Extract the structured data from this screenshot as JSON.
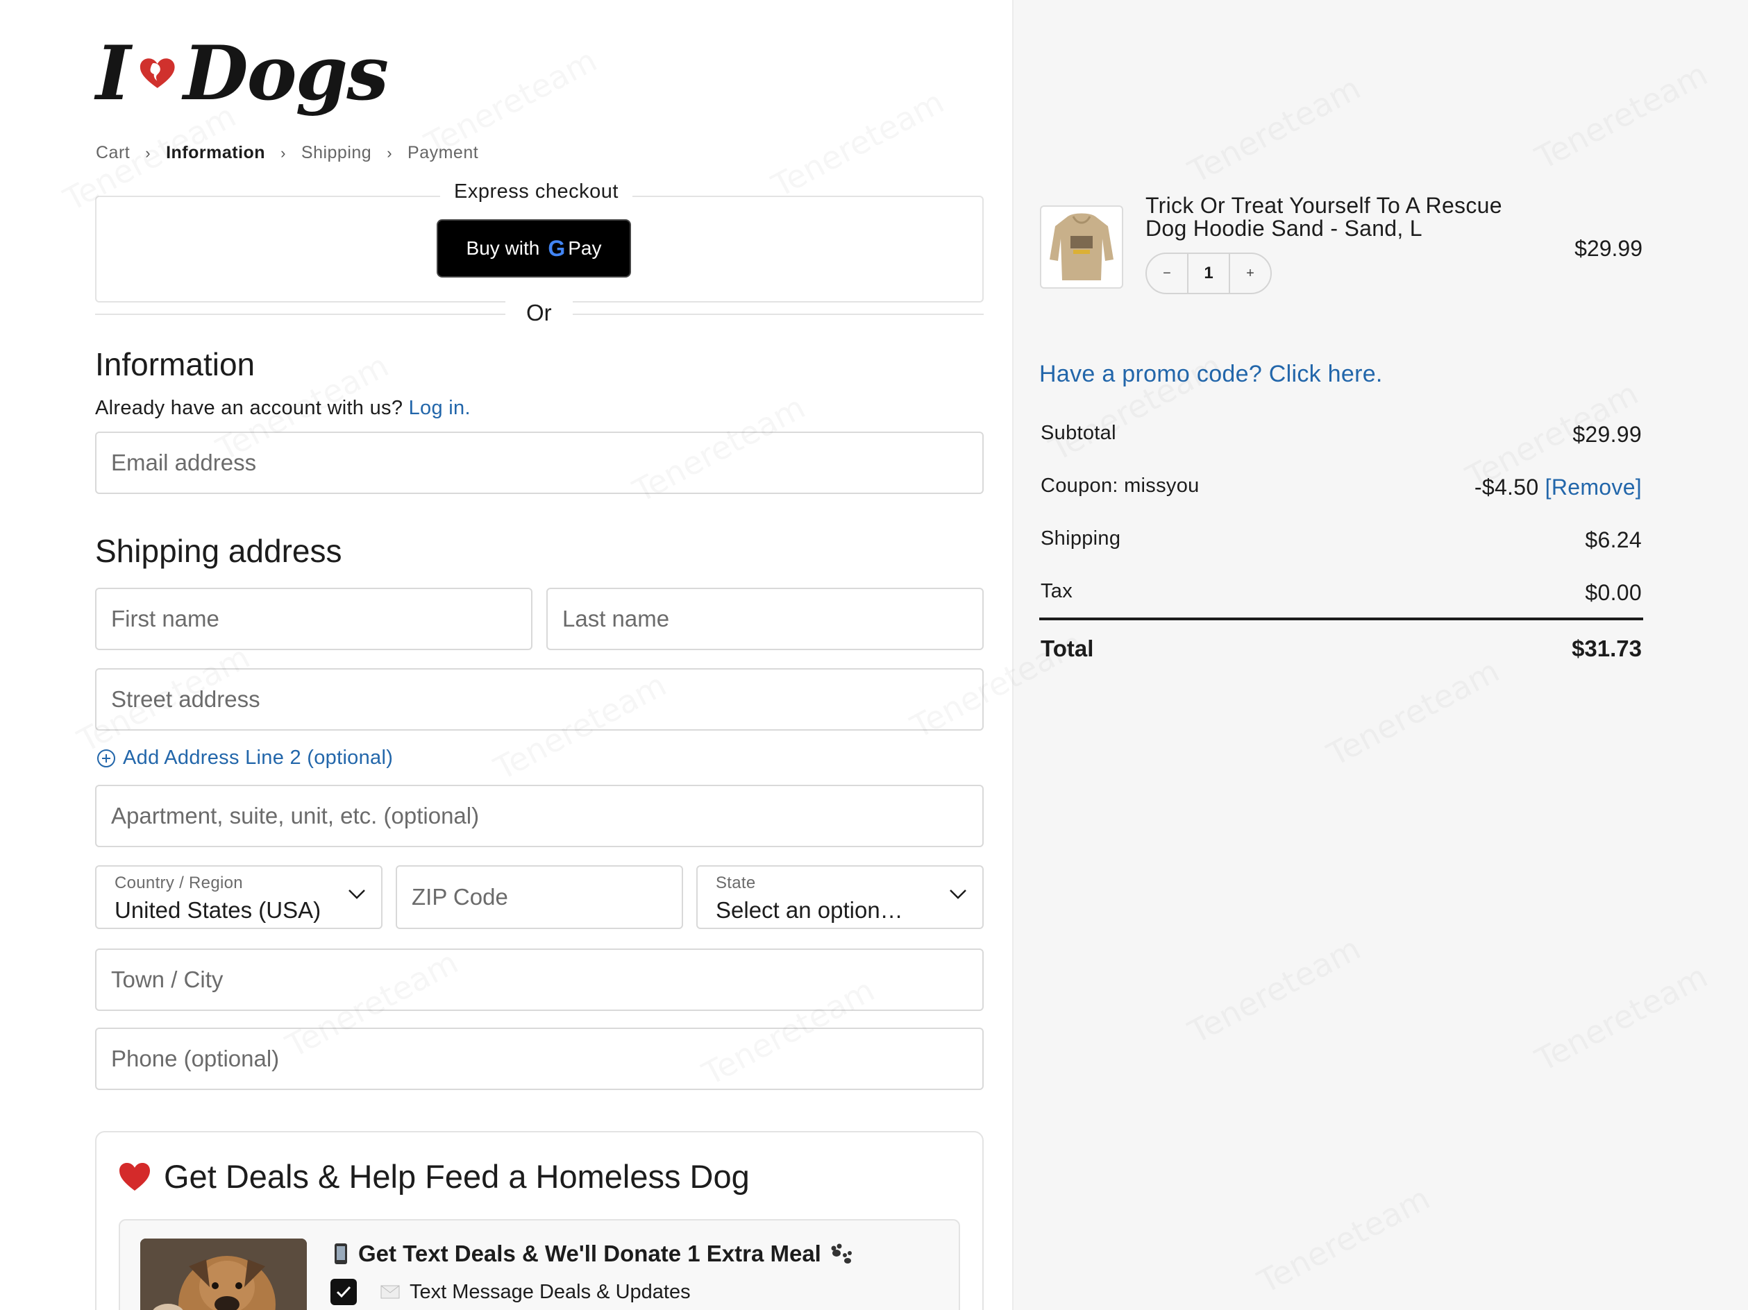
{
  "brand": {
    "logo_left": "I",
    "logo_right": "Dogs",
    "heart_color": "#d0312d"
  },
  "breadcrumb": [
    {
      "label": "Cart",
      "active": false
    },
    {
      "label": "Information",
      "active": true
    },
    {
      "label": "Shipping",
      "active": false
    },
    {
      "label": "Payment",
      "active": false
    }
  ],
  "express": {
    "label": "Express checkout",
    "button_prefix": "Buy with",
    "button_g": "G",
    "button_suffix": "Pay",
    "or_label": "Or"
  },
  "information": {
    "heading": "Information",
    "account_text": "Already have an account with us?",
    "login_link": "Log in.",
    "email_placeholder": "Email address"
  },
  "shipping": {
    "heading": "Shipping address",
    "first_name_placeholder": "First name",
    "last_name_placeholder": "Last name",
    "street_placeholder": "Street address",
    "add_line2_label": "Add Address Line 2 (optional)",
    "apartment_placeholder": "Apartment, suite, unit, etc. (optional)",
    "country_label": "Country / Region",
    "country_value": "United States (USA)",
    "zip_placeholder": "ZIP Code",
    "state_label": "State",
    "state_value": "Select an option…",
    "city_placeholder": "Town / City",
    "phone_placeholder": "Phone (optional)"
  },
  "deals": {
    "title": "Get Deals & Help Feed a Homeless Dog",
    "headline": "Get Text Deals & We'll Donate 1 Extra Meal",
    "checkbox_label": "Text Message Deals & Updates",
    "checkbox_checked": true
  },
  "cart": {
    "product_name": "Trick Or Treat Yourself To A Rescue Dog Hoodie Sand - Sand, L",
    "product_price": "$29.99",
    "quantity": "1",
    "qty_minus": "−",
    "qty_plus": "+",
    "promo_link": "Have a promo code? Click here.",
    "subtotal_label": "Subtotal",
    "subtotal_value": "$29.99",
    "coupon_label": "Coupon: missyou",
    "coupon_value": "-$4.50",
    "coupon_remove": "[Remove]",
    "shipping_label": "Shipping",
    "shipping_value": "$6.24",
    "tax_label": "Tax",
    "tax_value": "$0.00",
    "total_label": "Total",
    "total_value": "$31.73"
  },
  "colors": {
    "link": "#2266aa",
    "sidebar_bg": "#f6f6f6",
    "border": "#d9d9d9"
  }
}
